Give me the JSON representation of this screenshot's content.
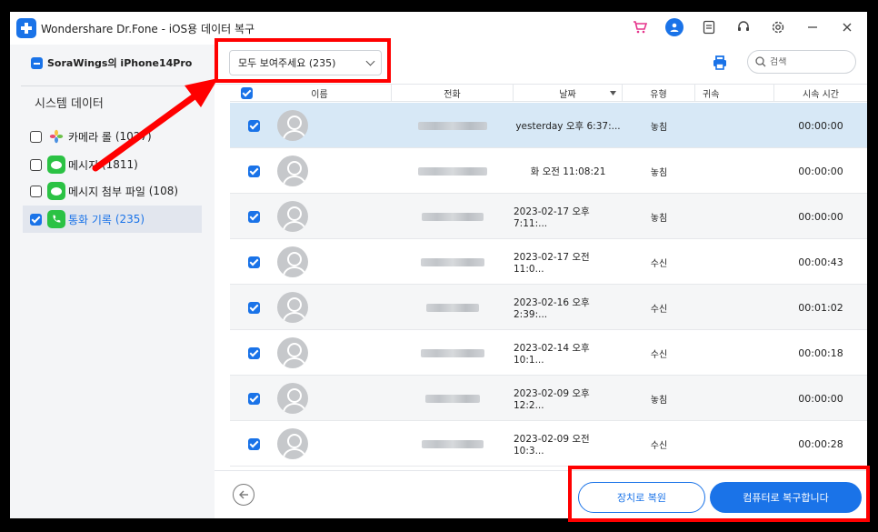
{
  "window": {
    "title": "Wondershare Dr.Fone - iOS용 데이터 복구"
  },
  "titlebar_icons": [
    "cart-icon",
    "account-icon",
    "feedback-icon",
    "support-icon",
    "settings-icon",
    "minimize-icon",
    "close-icon"
  ],
  "sidebar": {
    "device": "SoraWings의 iPhone14Pro",
    "section": "시스템 데이터",
    "items": [
      {
        "label": "카메라 롤",
        "count": "(1027)",
        "icon": "photos-icon",
        "checked": false
      },
      {
        "label": "메시지",
        "count": "(1811)",
        "icon": "messages-icon",
        "checked": false
      },
      {
        "label": "메시지 첨부 파일",
        "count": "(108)",
        "icon": "messages-icon",
        "checked": false
      },
      {
        "label": "통화 기록",
        "count": "(235)",
        "icon": "phone-icon",
        "checked": true
      }
    ]
  },
  "toolbar": {
    "filter": "모두 보여주세요 (235)",
    "search_placeholder": "검색"
  },
  "table": {
    "columns": [
      "이름",
      "전화",
      "날짜",
      "유형",
      "귀속",
      "시속 시간"
    ],
    "rows": [
      {
        "date": "yesterday 오후 6:37:...",
        "type": "놓침",
        "duration": "00:00:00"
      },
      {
        "date": "화 오전 11:08:21",
        "type": "놓침",
        "duration": "00:00:00"
      },
      {
        "date": "2023-02-17 오후 7:11:...",
        "type": "놓침",
        "duration": "00:00:00"
      },
      {
        "date": "2023-02-17 오전 11:0...",
        "type": "수신",
        "duration": "00:00:43"
      },
      {
        "date": "2023-02-16 오후 2:39:...",
        "type": "수신",
        "duration": "00:01:02"
      },
      {
        "date": "2023-02-14 오후 10:1...",
        "type": "수신",
        "duration": "00:00:18"
      },
      {
        "date": "2023-02-09 오후 12:2...",
        "type": "놓침",
        "duration": "00:00:00"
      },
      {
        "date": "2023-02-09 오전 10:3...",
        "type": "수신",
        "duration": "00:00:28"
      }
    ]
  },
  "footer": {
    "restore_device": "장치로 복원",
    "restore_pc": "컴퓨터로 복구합니다"
  },
  "colors": {
    "accent": "#1a73e8",
    "annotation": "#ff0000",
    "selected_row": "#d7e8f6"
  }
}
